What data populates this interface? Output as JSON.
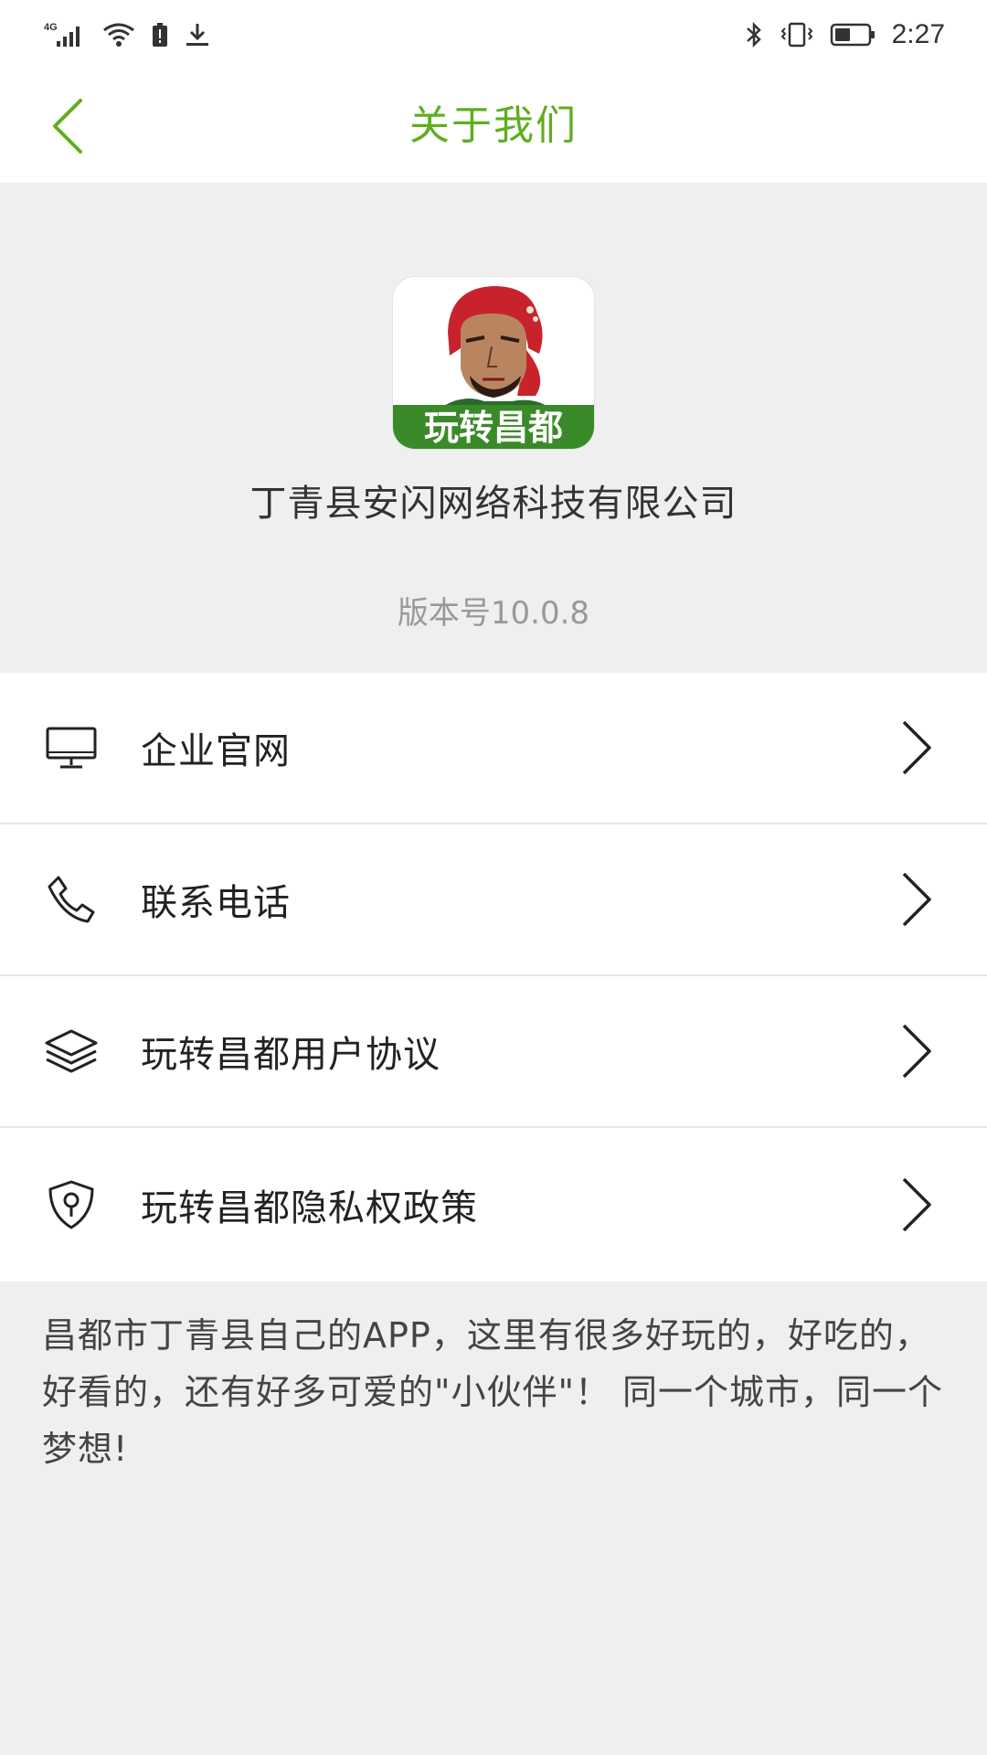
{
  "status_bar": {
    "network": "4G",
    "time": "2:27",
    "icons": [
      "signal-icon",
      "wifi-icon",
      "battery-alert-icon",
      "download-icon",
      "bluetooth-icon",
      "vibrate-icon",
      "battery-icon"
    ]
  },
  "header": {
    "title": "关于我们",
    "back_icon": "chevron-left-icon"
  },
  "about": {
    "logo_text": "玩转昌都",
    "company_name": "丁青县安闪网络科技有限公司",
    "version": "版本号10.0.8"
  },
  "menu": {
    "items": [
      {
        "label": "企业官网",
        "icon": "monitor-icon"
      },
      {
        "label": "联系电话",
        "icon": "phone-icon"
      },
      {
        "label": "玩转昌都用户协议",
        "icon": "layers-icon"
      },
      {
        "label": "玩转昌都隐私权政策",
        "icon": "shield-key-icon"
      }
    ]
  },
  "description": "昌都市丁青县自己的APP，这里有很多好玩的，好吃的，好看的，还有好多可爱的\"小伙伴\"！ 同一个城市，同一个梦想!",
  "colors": {
    "accent": "#5fae1e",
    "background": "#efefef",
    "logo_banner": "#3a8a2a"
  }
}
